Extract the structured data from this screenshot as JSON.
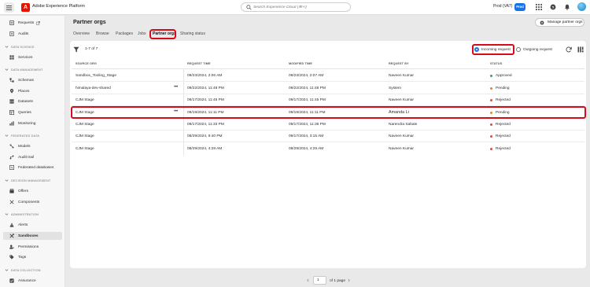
{
  "app": {
    "title": "Adobe Experience Platform",
    "search_placeholder": "Search Experience Cloud (⌘+/)",
    "org_name": "Prod (VA7)",
    "env_badge": "Prod"
  },
  "sidebar": {
    "items": [
      {
        "label": "Requests",
        "icon": "requests-icon",
        "external": true
      },
      {
        "label": "Audits",
        "icon": "audits-icon"
      }
    ],
    "sections": [
      {
        "title": "DATA SCIENCE",
        "items": [
          {
            "label": "Services",
            "icon": "services-icon"
          }
        ]
      },
      {
        "title": "DATA MANAGEMENT",
        "items": [
          {
            "label": "Schemas",
            "icon": "schemas-icon"
          },
          {
            "label": "Places",
            "icon": "places-icon"
          },
          {
            "label": "Datasets",
            "icon": "datasets-icon"
          },
          {
            "label": "Queries",
            "icon": "queries-icon"
          },
          {
            "label": "Monitoring",
            "icon": "monitoring-icon"
          }
        ]
      },
      {
        "title": "FEDERATED DATA",
        "items": [
          {
            "label": "Models",
            "icon": "models-icon"
          },
          {
            "label": "Audit trail",
            "icon": "audit-trail-icon"
          },
          {
            "label": "Federated databases",
            "icon": "federated-databases-icon"
          }
        ]
      },
      {
        "title": "DECISION MANAGEMENT",
        "items": [
          {
            "label": "Offers",
            "icon": "offers-icon"
          },
          {
            "label": "Components",
            "icon": "components-icon"
          }
        ]
      },
      {
        "title": "ADMINISTRATION",
        "items": [
          {
            "label": "Alerts",
            "icon": "alerts-icon"
          },
          {
            "label": "Sandboxes",
            "icon": "sandboxes-icon",
            "active": true
          },
          {
            "label": "Permissions",
            "icon": "permissions-icon"
          },
          {
            "label": "Tags",
            "icon": "tags-icon"
          }
        ]
      },
      {
        "title": "DATA COLLECTION",
        "items": [
          {
            "label": "Assurance",
            "icon": "assurance-icon"
          }
        ]
      }
    ]
  },
  "page": {
    "title": "Partner orgs",
    "manage_button": "Manage partner orgs",
    "tabs": [
      "Overview",
      "Browse",
      "Packages",
      "Jobs",
      "Partner orgs",
      "Sharing status"
    ],
    "active_tab": "Partner orgs"
  },
  "toolbar": {
    "count": "1-7 of 7",
    "radio_incoming": "Incoming request",
    "radio_outgoing": "Outgoing request",
    "selected": "Incoming request"
  },
  "table": {
    "columns": [
      "SOURCE ORG",
      "REQUEST TIME",
      "MODIFIED TIME",
      "REQUEST BY",
      "STATUS"
    ],
    "rows": [
      {
        "source": "Sandbox_Tooling_Stage",
        "request_time": "09/23/2024, 2:06 AM",
        "modified_time": "09/23/2024, 2:07 AM",
        "request_by": "Naveen Kumar",
        "status": "Approved",
        "status_color": "#2d9d78",
        "more": false
      },
      {
        "source": "himalaya-dev-shared",
        "request_time": "09/22/2024, 11:48 PM",
        "modified_time": "09/22/2024, 11:48 PM",
        "request_by": "System",
        "status": "Pending",
        "status_color": "#e68619",
        "more": true
      },
      {
        "source": "CJM Stage",
        "request_time": "09/17/2024, 11:45 PM",
        "modified_time": "09/17/2024, 11:45 PM",
        "request_by": "Naveen Kumar",
        "status": "Rejected",
        "status_color": "#e34850",
        "more": false
      },
      {
        "source": "CJM Stage",
        "request_time": "09/19/2024, 11:11 PM",
        "modified_time": "09/19/2024, 11:11 PM",
        "request_by": "Amanda Li",
        "status": "Pending",
        "status_color": "#e68619",
        "more": true
      },
      {
        "source": "CJM Stage",
        "request_time": "09/17/2024, 11:33 PM",
        "modified_time": "09/17/2024, 11:36 PM",
        "request_by": "Narendra Sabale",
        "status": "Rejected",
        "status_color": "#e34850",
        "more": false
      },
      {
        "source": "CJM Stage",
        "request_time": "08/29/2024, 9:40 PM",
        "modified_time": "09/17/2024, 3:15 AM",
        "request_by": "Naveen Kumar",
        "status": "Rejected",
        "status_color": "#e34850",
        "more": false
      },
      {
        "source": "CJM Stage",
        "request_time": "08/29/2024, 4:28 AM",
        "modified_time": "08/29/2024, 4:29 AM",
        "request_by": "Naveen Kumar",
        "status": "Rejected",
        "status_color": "#e34850",
        "more": false
      }
    ],
    "highlighted_row": "Amanda Li"
  },
  "pagination": {
    "page": "1",
    "of_label": "of 1 page"
  },
  "colors": {
    "accent": "#1473e6",
    "highlight": "#d50a1b",
    "brand": "#eb1000"
  }
}
